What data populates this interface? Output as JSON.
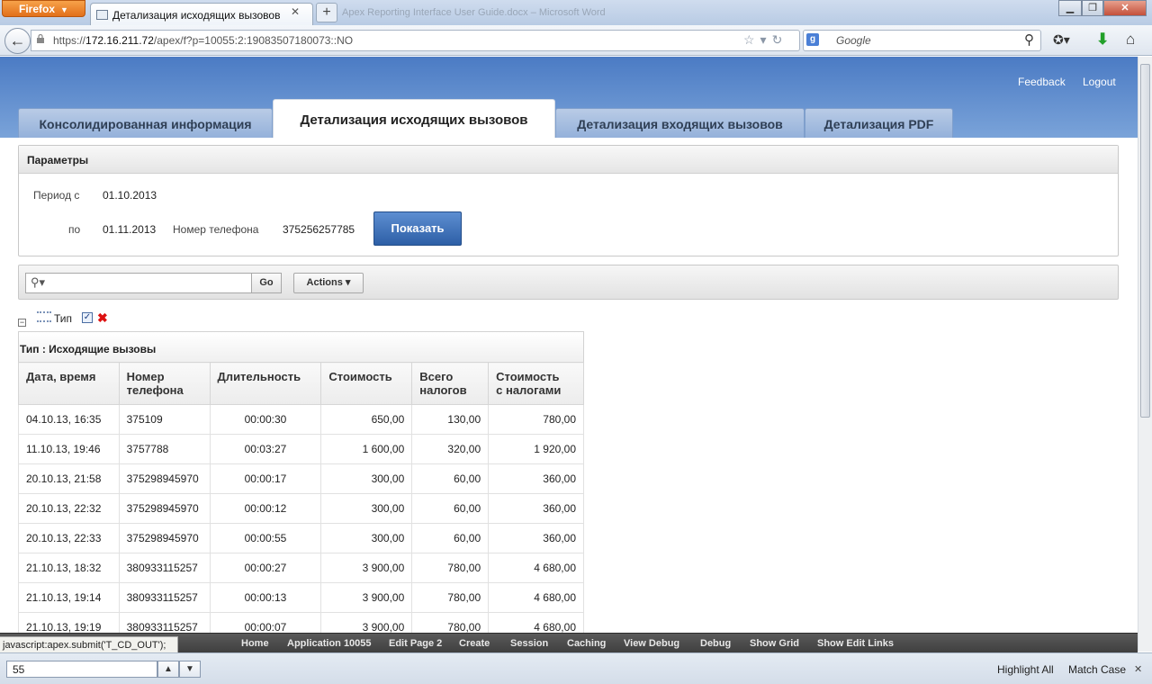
{
  "browser": {
    "menu_button": "Firefox",
    "tab_title": "Детализация исходящих вызовов",
    "background_window_title": "Apex Reporting Interface User Guide.docx – Microsoft Word",
    "url_prefix": "https://",
    "url_host": "172.16.211.72",
    "url_path": "/apex/f?p=10055:2:19083507180073::NO",
    "search_placeholder": "Google",
    "search_engine_icon": "g"
  },
  "header": {
    "feedback": "Feedback",
    "logout": "Logout",
    "tabs": [
      {
        "label": "Консолидированная информация",
        "active": false
      },
      {
        "label": "Детализация исходящих вызовов",
        "active": true
      },
      {
        "label": "Детализация входящих вызовов",
        "active": false
      },
      {
        "label": "Детализация PDF",
        "active": false
      }
    ]
  },
  "params": {
    "title": "Параметры",
    "from_label": "Период с",
    "from_value": "01.10.2013",
    "to_label": "по",
    "to_value": "01.11.2013",
    "phone_label": "Номер телефона",
    "phone_value": "375256257785",
    "show_button": "Показать"
  },
  "report": {
    "go_button": "Go",
    "actions_button": "Actions ▾",
    "filter_label": "Тип",
    "group_header": "Тип : Исходящие вызовы",
    "columns": [
      "Дата, время",
      "Номер\nтелефона",
      "Длительность",
      "Стоимость",
      "Всего\nналогов",
      "Стоимость\nс налогами"
    ],
    "rows": [
      [
        "04.10.13, 16:35",
        "375109",
        "00:00:30",
        "650,00",
        "130,00",
        "780,00"
      ],
      [
        "11.10.13, 19:46",
        "3757788",
        "00:03:27",
        "1 600,00",
        "320,00",
        "1 920,00"
      ],
      [
        "20.10.13, 21:58",
        "375298945970",
        "00:00:17",
        "300,00",
        "60,00",
        "360,00"
      ],
      [
        "20.10.13, 22:32",
        "375298945970",
        "00:00:12",
        "300,00",
        "60,00",
        "360,00"
      ],
      [
        "20.10.13, 22:33",
        "375298945970",
        "00:00:55",
        "300,00",
        "60,00",
        "360,00"
      ],
      [
        "21.10.13, 18:32",
        "380933115257",
        "00:00:27",
        "3 900,00",
        "780,00",
        "4 680,00"
      ],
      [
        "21.10.13, 19:14",
        "380933115257",
        "00:00:13",
        "3 900,00",
        "780,00",
        "4 680,00"
      ],
      [
        "21.10.13, 19:19",
        "380933115257",
        "00:00:07",
        "3 900,00",
        "780,00",
        "4 680,00"
      ]
    ]
  },
  "devbar": {
    "links": [
      "Home",
      "Application 10055",
      "Edit Page 2",
      "Create",
      "Session",
      "Caching",
      "View Debug",
      "Debug",
      "Show Grid",
      "Show Edit Links"
    ]
  },
  "status_text": "javascript:apex.submit('T_CD_OUT');",
  "findbar": {
    "value": "55",
    "highlight_all": "Highlight All",
    "match_case": "Match Case"
  },
  "colors": {
    "header_blue": "#4b7bc4",
    "button_blue": "#2d5fa6"
  }
}
